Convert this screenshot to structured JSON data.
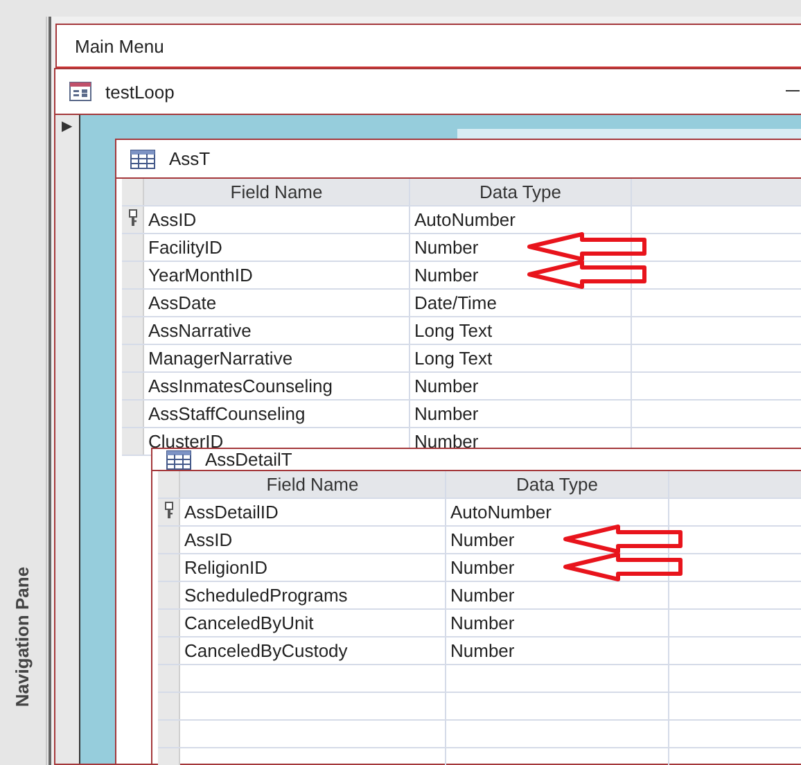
{
  "navigation_pane": {
    "title": "Navigation Pane"
  },
  "main_menu": {
    "title": "Main Menu"
  },
  "form": {
    "title": "testLoop",
    "record_selector": "▶"
  },
  "tables": [
    {
      "title": "AssT",
      "columns": [
        "Field Name",
        "Data Type"
      ],
      "rows": [
        {
          "field": "AssID",
          "type": "AutoNumber",
          "primary_key": true,
          "marked": false
        },
        {
          "field": "FacilityID",
          "type": "Number",
          "primary_key": false,
          "marked": true
        },
        {
          "field": "YearMonthID",
          "type": "Number",
          "primary_key": false,
          "marked": true
        },
        {
          "field": "AssDate",
          "type": "Date/Time",
          "primary_key": false,
          "marked": false
        },
        {
          "field": "AssNarrative",
          "type": "Long Text",
          "primary_key": false,
          "marked": false
        },
        {
          "field": "ManagerNarrative",
          "type": "Long Text",
          "primary_key": false,
          "marked": false
        },
        {
          "field": "AssInmatesCounseling",
          "type": "Number",
          "primary_key": false,
          "marked": false
        },
        {
          "field": "AssStaffCounseling",
          "type": "Number",
          "primary_key": false,
          "marked": false
        },
        {
          "field": "ClusterID",
          "type": "Number",
          "primary_key": false,
          "marked": false
        }
      ]
    },
    {
      "title": "AssDetailT",
      "columns": [
        "Field Name",
        "Data Type"
      ],
      "rows": [
        {
          "field": "AssDetailID",
          "type": "AutoNumber",
          "primary_key": true,
          "marked": false
        },
        {
          "field": "AssID",
          "type": "Number",
          "primary_key": false,
          "marked": true
        },
        {
          "field": "ReligionID",
          "type": "Number",
          "primary_key": false,
          "marked": true
        },
        {
          "field": "ScheduledPrograms",
          "type": "Number",
          "primary_key": false,
          "marked": false
        },
        {
          "field": "CanceledByUnit",
          "type": "Number",
          "primary_key": false,
          "marked": false
        },
        {
          "field": "CanceledByCustody",
          "type": "Number",
          "primary_key": false,
          "marked": false
        }
      ]
    }
  ]
}
